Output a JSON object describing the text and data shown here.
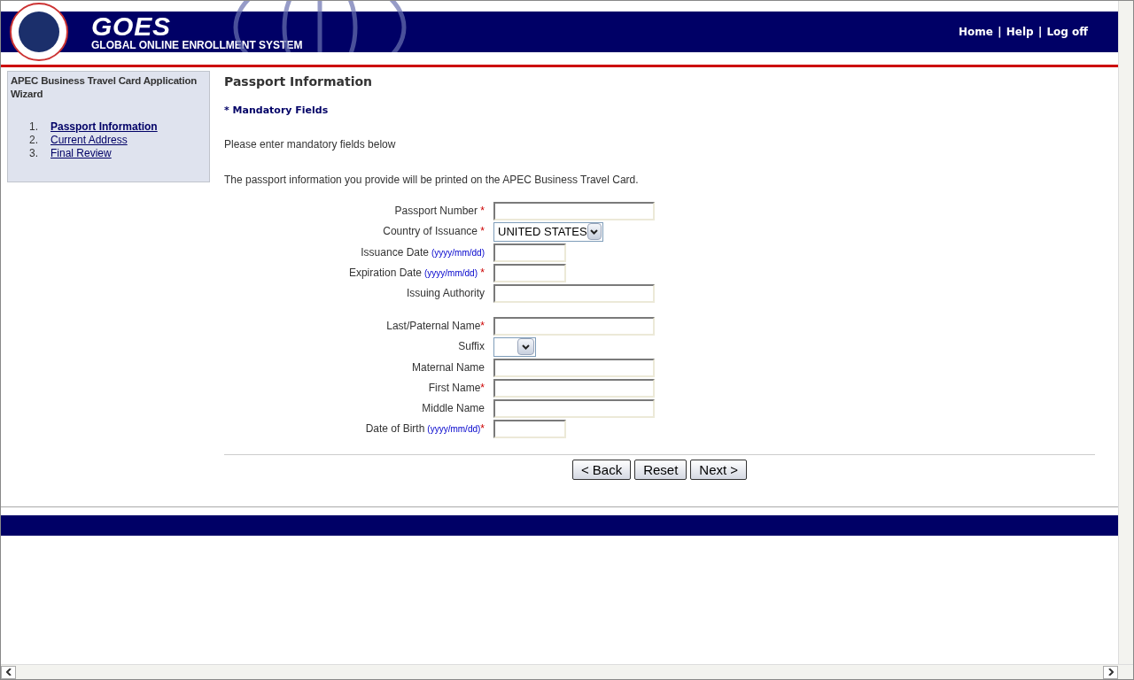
{
  "header": {
    "logo_text": "GOES",
    "logo_subtitle": "GLOBAL ONLINE ENROLLMENT SYSTEM",
    "links": [
      "Home",
      "Help",
      "Log off"
    ],
    "separator": "|"
  },
  "sidebar": {
    "title": "APEC Business Travel Card Application Wizard",
    "steps": [
      {
        "number": "1.",
        "label": "Passport Information",
        "selected": true
      },
      {
        "number": "2.",
        "label": "Current Address",
        "selected": false
      },
      {
        "number": "3.",
        "label": "Final Review",
        "selected": false
      }
    ]
  },
  "page": {
    "title": "Passport Information",
    "mandatory_note": "* Mandatory Fields",
    "instruction": "Please enter mandatory fields below",
    "info": "The passport information you provide will be printed on the APEC Business Travel Card."
  },
  "form": {
    "groups": [
      [
        {
          "label": "Passport Number",
          "star": " *",
          "kind": "text"
        },
        {
          "label": "Country of Issuance",
          "star": " *",
          "kind": "select",
          "value": "UNITED STATES"
        },
        {
          "label": "Issuance Date",
          "hint": "(yyyy/mm/dd)",
          "kind": "date"
        },
        {
          "label": "Expiration Date",
          "hint": "(yyyy/mm/dd)",
          "star": " *",
          "kind": "date"
        },
        {
          "label": "Issuing Authority",
          "kind": "text"
        }
      ],
      [
        {
          "label": "Last/Paternal Name",
          "star": "*",
          "kind": "text"
        },
        {
          "label": "Suffix",
          "kind": "select"
        },
        {
          "label": "Maternal Name",
          "kind": "text"
        },
        {
          "label": "First Name",
          "star": "*",
          "kind": "text"
        },
        {
          "label": "Middle Name",
          "kind": "text"
        },
        {
          "label": "Date of Birth",
          "hint": "(yyyy/mm/dd)",
          "star": "*",
          "kind": "date"
        }
      ]
    ]
  },
  "buttons": [
    "< Back",
    "Reset",
    "Next >"
  ]
}
